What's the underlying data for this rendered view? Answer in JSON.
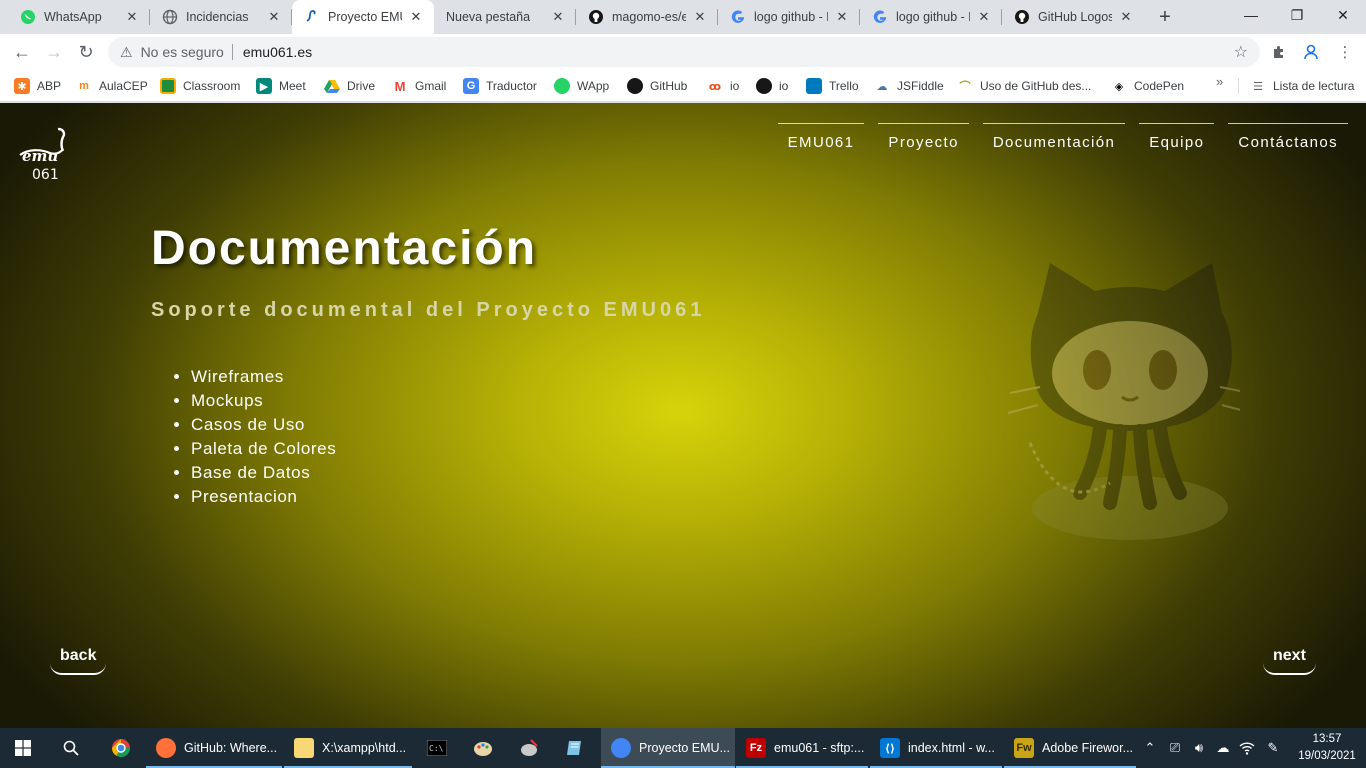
{
  "browser": {
    "tabs": [
      {
        "title": "WhatsApp",
        "icon": "whatsapp-icon",
        "active": false
      },
      {
        "title": "Incidencias",
        "icon": "globe-icon",
        "active": false
      },
      {
        "title": "Proyecto EMU",
        "icon": "emu-favicon-icon",
        "active": true
      },
      {
        "title": "Nueva pestaña",
        "icon": "none",
        "active": false
      },
      {
        "title": "magomo-es/er",
        "icon": "github-icon",
        "active": false
      },
      {
        "title": "logo github - E",
        "icon": "google-icon",
        "active": false
      },
      {
        "title": "logo github - E",
        "icon": "google-icon",
        "active": false
      },
      {
        "title": "GitHub Logos",
        "icon": "github-icon",
        "active": false
      }
    ],
    "close_glyph": "✕",
    "new_tab_glyph": "+",
    "window_controls": {
      "minimize": "—",
      "maximize": "❐",
      "close": "✕"
    },
    "address": {
      "security_label": "No es seguro",
      "url": "emu061.es"
    },
    "bookmarks": [
      {
        "label": "ABP",
        "icon": "xampp-icon",
        "color": "#fb7a24"
      },
      {
        "label": "AulaCEP",
        "icon": "moodle-icon",
        "color": "#f98012"
      },
      {
        "label": "Classroom",
        "icon": "classroom-icon",
        "color": "#f9ab00"
      },
      {
        "label": "Meet",
        "icon": "meet-icon",
        "color": "#00897b"
      },
      {
        "label": "Drive",
        "icon": "drive-icon",
        "color": "#1fa463"
      },
      {
        "label": "Gmail",
        "icon": "gmail-icon",
        "color": "#ea4335"
      },
      {
        "label": "Traductor",
        "icon": "translate-icon",
        "color": "#4285f4"
      },
      {
        "label": "WApp",
        "icon": "whatsapp-icon",
        "color": "#25d366"
      },
      {
        "label": "GitHub",
        "icon": "github-icon",
        "color": "#181717"
      },
      {
        "label": "io",
        "icon": "gitpod-icon",
        "color": "#e8501c"
      },
      {
        "label": "io",
        "icon": "github-icon",
        "color": "#181717"
      },
      {
        "label": "Trello",
        "icon": "trello-icon",
        "color": "#0079bf"
      },
      {
        "label": "JSFiddle",
        "icon": "jsfiddle-icon",
        "color": "#4679a4"
      },
      {
        "label": "Uso de GitHub des...",
        "icon": "android-icon",
        "color": "#a4a61d"
      },
      {
        "label": "CodePen",
        "icon": "codepen-icon",
        "color": "#000000"
      }
    ],
    "more_glyph": "»",
    "reading_list": "Lista de lectura"
  },
  "site": {
    "logo_text": "emu 061",
    "nav": [
      "EMU061",
      "Proyecto",
      "Documentación",
      "Equipo",
      "Contáctanos"
    ],
    "title": "Documentación",
    "subtitle": "Soporte documental del Proyecto EMU061",
    "doc_items": [
      "Wireframes",
      "Mockups",
      "Casos de Uso",
      "Paleta de Colores",
      "Base de Datos",
      "Presentacion"
    ],
    "back_label": "back",
    "next_label": "next",
    "accent_colors": {
      "gradient_center": "#d7d30a",
      "gradient_edge": "#1a1905"
    }
  },
  "taskbar": {
    "apps": [
      {
        "label": "GitHub: Where...",
        "icon": "firefox-icon",
        "color": "#ff7139",
        "open": true,
        "active": false
      },
      {
        "label": "X:\\xampp\\htd...",
        "icon": "folder-icon",
        "color": "#f8d775",
        "open": true,
        "active": false
      },
      {
        "label": "Proyecto EMU...",
        "icon": "chrome-icon",
        "color": "#4285f4",
        "open": true,
        "active": true
      },
      {
        "label": "emu061 - sftp:...",
        "icon": "filezilla-icon",
        "color": "#bf0000",
        "open": true,
        "active": false
      },
      {
        "label": "index.html - w...",
        "icon": "vscode-icon",
        "color": "#0078d4",
        "open": true,
        "active": false
      },
      {
        "label": "Adobe Firewor...",
        "icon": "fireworks-icon",
        "color": "#c9a416",
        "open": true,
        "active": false
      }
    ],
    "clock_time": "13:57",
    "clock_date": "19/03/2021"
  }
}
